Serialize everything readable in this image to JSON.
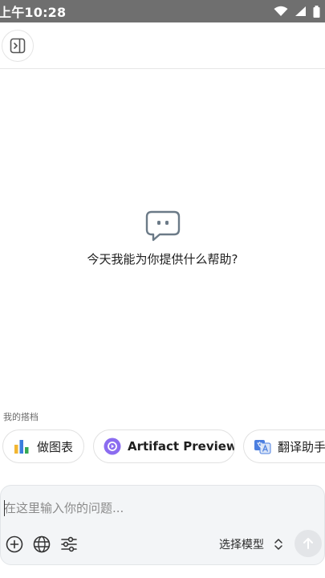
{
  "status_bar": {
    "time": "上午10:28",
    "icons": [
      "wifi-icon",
      "signal-icon",
      "battery-icon"
    ]
  },
  "topbar": {
    "toggle_icon": "sidebar-toggle-icon"
  },
  "empty_state": {
    "icon": "chat-bubble-icon",
    "text": "今天我能为你提供什么帮助?"
  },
  "assistants": {
    "label": "我的搭档",
    "items": [
      {
        "label": "做图表",
        "icon": "bar-chart-icon"
      },
      {
        "label": "Artifact Preview",
        "icon": "play-circle-icon"
      },
      {
        "label": "翻译助手",
        "icon": "translate-icon"
      }
    ]
  },
  "composer": {
    "placeholder": "在这里输入你的问题...",
    "value": "",
    "tools": [
      "plus-circle-icon",
      "globe-icon",
      "sliders-icon"
    ],
    "model_label": "选择模型",
    "send_icon": "arrow-up-icon"
  },
  "colors": {
    "status_bar": "#6f6f6f",
    "composer_bg": "#f3f5f7",
    "icon_gray": "#6b7a87",
    "artifact_purple": "#8b6cf0"
  }
}
